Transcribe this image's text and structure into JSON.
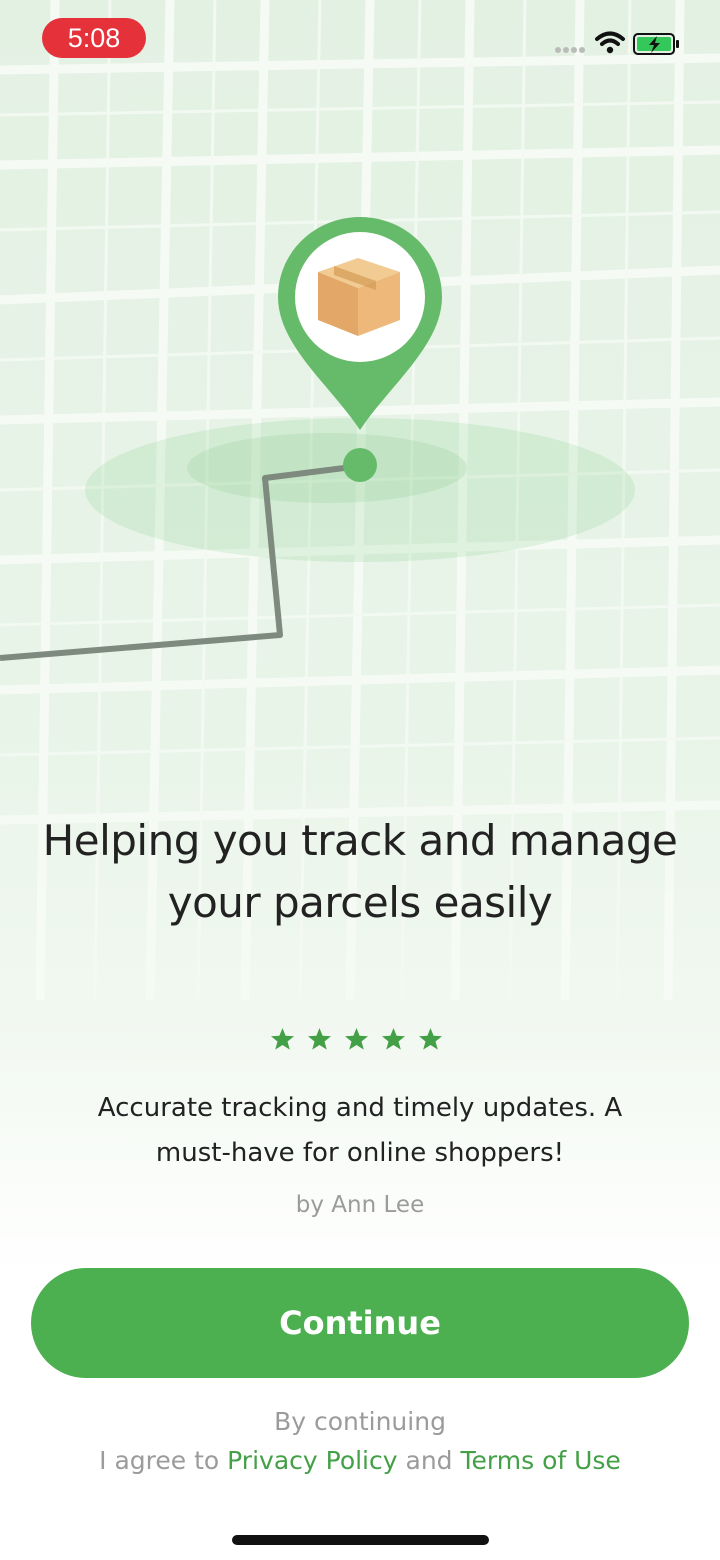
{
  "status_bar": {
    "time": "5:08",
    "icons": [
      "signal-dots-icon",
      "wifi-icon",
      "battery-charging-icon"
    ]
  },
  "hero": {
    "illustration": "map-pin-parcel-icon",
    "colors": {
      "pin": "#66bb6a",
      "route": "#7d8a7d",
      "box": "#e8b878"
    }
  },
  "headline": {
    "line1": "Helping you track and manage",
    "line2": "your parcels easily"
  },
  "review": {
    "rating": 5,
    "rating_max": 5,
    "text_line1": "Accurate tracking and timely updates. A",
    "text_line2": "must-have for online shoppers!",
    "author": "by Ann Lee"
  },
  "continue_label": "Continue",
  "legal": {
    "line1": "By continuing",
    "prefix": "I agree to",
    "privacy_link": "Privacy Policy",
    "conjunction": "and",
    "terms_link": "Terms of Use"
  },
  "colors": {
    "accent": "#4caf50",
    "link": "#43a047",
    "recording_pill": "#e5313a",
    "muted_text": "#9b9b9b"
  }
}
